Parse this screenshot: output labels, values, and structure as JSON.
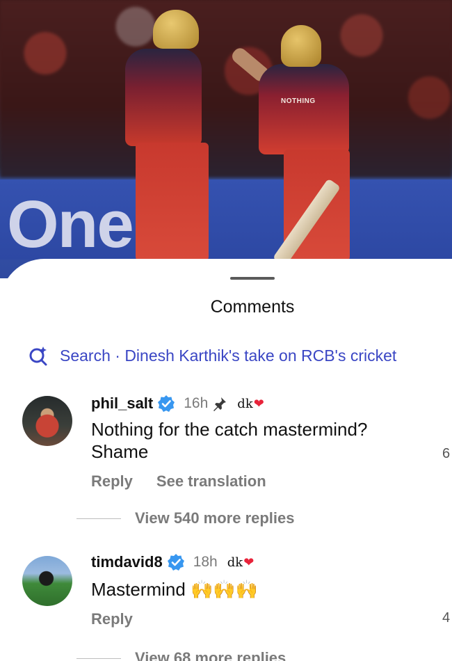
{
  "video": {
    "board_text": "One",
    "shirt_text": "NOTHING"
  },
  "sheet": {
    "title": "Comments",
    "search_label": "Search · Dinesh Karthik's take on RCB's cricket"
  },
  "comments": [
    {
      "username": "phil_salt",
      "time": "16h",
      "creator_like_badge": "dk",
      "lines": [
        "Nothing for the catch mastermind?",
        "Shame"
      ],
      "reply_label": "Reply",
      "translate_label": "See translation",
      "like_count": "6",
      "view_replies_label": "View 540 more replies"
    },
    {
      "username": "timdavid8",
      "time": "18h",
      "creator_like_badge": "dk",
      "text": "Mastermind",
      "emoji": "🙌🙌🙌",
      "reply_label": "Reply",
      "like_count": "4",
      "view_replies_label": "View 68 more replies"
    }
  ],
  "colors": {
    "accent_blue": "#3a46c4",
    "verified_blue": "#3897f0",
    "heart_red": "#e8233a"
  },
  "icons": [
    "sparkle-search-icon",
    "verified-badge-icon",
    "pin-icon",
    "heart-icon"
  ]
}
